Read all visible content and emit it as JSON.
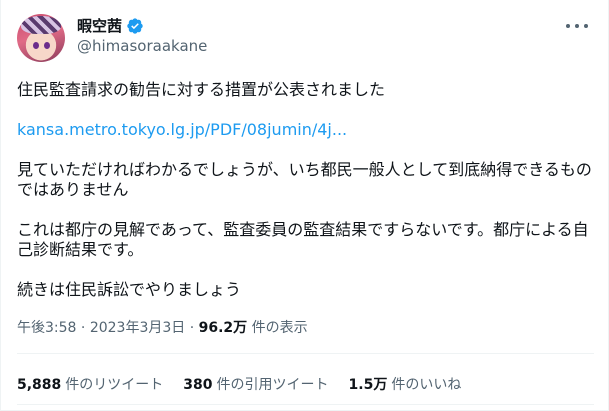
{
  "author": {
    "name": "暇空茜",
    "handle": "@himasoraakane",
    "verified_color": "#1d9bf0"
  },
  "tweet": {
    "paragraphs": [
      "住民監査請求の勧告に対する措置が公表されました",
      "見ていただければわかるでしょうが、いち都民一般人として到底納得できるものではありません",
      "これは都庁の見解であって、監査委員の監査結果ですらないです。都庁による自己診断結果です。",
      "続きは住民訴訟でやりましょう"
    ],
    "link": "kansa.metro.tokyo.lg.jp/PDF/08jumin/4j..."
  },
  "meta": {
    "time": "午後3:58",
    "sep1": " · ",
    "date": "2023年3月3日",
    "sep2": " · ",
    "views_count": "96.2万",
    "views_label": " 件の表示"
  },
  "stats": {
    "retweets_count": "5,888",
    "retweets_label": "件のリツイート",
    "quotes_count": "380",
    "quotes_label": "件の引用ツイート",
    "likes_count": "1.5万",
    "likes_label": "件のいいね"
  },
  "icons": {
    "avatar": "avatar-image",
    "verified": "verified-badge-icon",
    "more": "more-options-icon"
  }
}
